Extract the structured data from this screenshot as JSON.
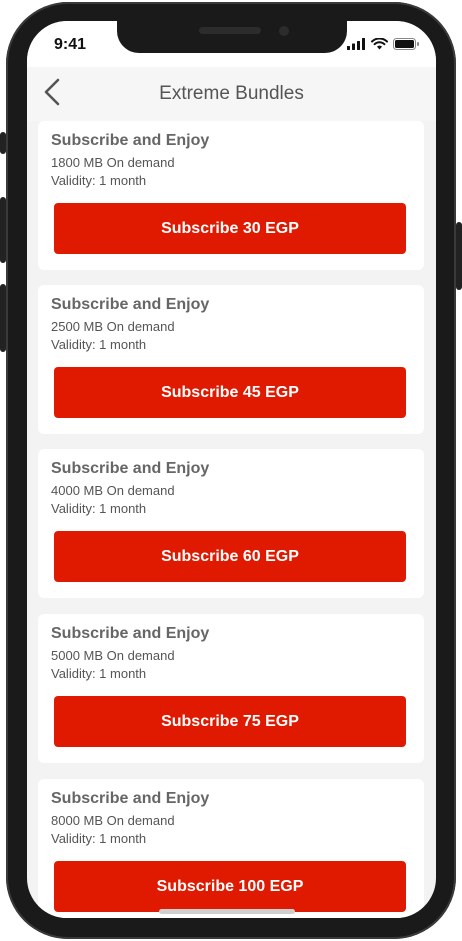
{
  "status_bar": {
    "time": "9:41"
  },
  "header": {
    "title": "Extreme Bundles",
    "back_icon": "chevron-left-icon"
  },
  "bundles": [
    {
      "title": "Subscribe and Enjoy",
      "data": "1800 MB On demand",
      "validity": "Validity: 1 month",
      "button": "Subscribe 30 EGP"
    },
    {
      "title": "Subscribe and Enjoy",
      "data": "2500 MB On demand",
      "validity": "Validity: 1 month",
      "button": "Subscribe 45 EGP"
    },
    {
      "title": "Subscribe and Enjoy",
      "data": "4000 MB On demand",
      "validity": "Validity: 1 month",
      "button": "Subscribe 60 EGP"
    },
    {
      "title": "Subscribe and Enjoy",
      "data": "5000 MB On demand",
      "validity": "Validity: 1 month",
      "button": "Subscribe 75 EGP"
    },
    {
      "title": "Subscribe and Enjoy",
      "data": "8000 MB On demand",
      "validity": "Validity: 1 month",
      "button": "Subscribe 100 EGP"
    }
  ],
  "colors": {
    "accent": "#e01a00",
    "card_background": "#ffffff",
    "screen_background": "#f3f3f3"
  }
}
